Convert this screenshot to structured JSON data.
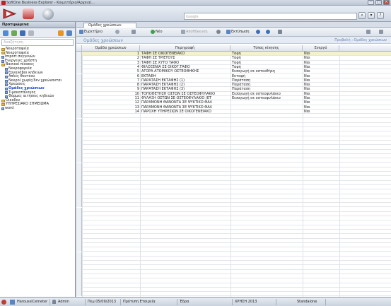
{
  "window": {
    "title": "SoftOne Business Explorer - Κοιμητήριο/Αρχεια/..."
  },
  "search": {
    "placeholder": "Google"
  },
  "sidebar": {
    "title": "Προτιμώμενα",
    "search_placeholder": "Αναζήτηση",
    "items": [
      {
        "label": "Νεκροταφεία",
        "indent": 0,
        "kind": "folder"
      },
      {
        "label": "Νεκροταφεία",
        "indent": 0,
        "kind": "folder"
      },
      {
        "label": "Import συγγενών",
        "indent": 0,
        "kind": "doc"
      },
      {
        "label": "Ενεργειες χρήστη",
        "indent": 0,
        "kind": "doc"
      },
      {
        "label": "Βασικοί πίνακες",
        "indent": 0,
        "kind": "folder"
      },
      {
        "label": "Νεκροφορεία",
        "indent": 1,
        "kind": "doc"
      },
      {
        "label": "Εργολάβοι κηδειών",
        "indent": 1,
        "kind": "doc"
      },
      {
        "label": "Απλές θουτέου",
        "indent": 1,
        "kind": "doc"
      },
      {
        "label": "Νεκροί χωρίς/δεν χρεώνονται",
        "indent": 1,
        "kind": "doc"
      },
      {
        "label": "Χρεώσεις",
        "indent": 1,
        "kind": "doc"
      },
      {
        "label": "Ομάδες χρεώσεων",
        "indent": 1,
        "kind": "doc",
        "selected": true
      },
      {
        "label": "Τιμοκατάλογος",
        "indent": 1,
        "kind": "doc"
      },
      {
        "label": "Φόρμες αιτήσεις κηδειών",
        "indent": 1,
        "kind": "doc"
      },
      {
        "label": "Οικοδεν",
        "indent": 0,
        "kind": "folder"
      },
      {
        "label": "ΥΠΗΡΕΣΙΑΚΟ ΣΗΜΕΙΩΜΑ",
        "indent": 0,
        "kind": "folder"
      },
      {
        "label": "word",
        "indent": 0,
        "kind": "doc"
      }
    ]
  },
  "tab": {
    "label": "Ομάδες χρεώσεων"
  },
  "toolbar": {
    "search_label": "Ευρετήριο",
    "new_label": "Νέο",
    "save_label": "Αποθήκευση",
    "print_label": "Εκτύπωση"
  },
  "subheader": {
    "left": "Ομάδες χρεώσεων",
    "right": "Προβολή : Ομάδες χρεώσεων"
  },
  "table": {
    "columns": [
      "Ομάδα χρεώσεων",
      "Περιγραφή",
      "Τύπος κίνησης",
      "Ενεργό"
    ],
    "rows": [
      {
        "num": "1",
        "desc": "ΤΑΦΗ ΣΕ ΟΙΚΟΓΕΝΕΙΑΚΟ",
        "type": "Ταφή",
        "active": "Ναι"
      },
      {
        "num": "2",
        "desc": "ΤΑΦΗ ΣΕ ΤΡΙΕΤΟΥΣ",
        "type": "Ταφή",
        "active": "Ναι"
      },
      {
        "num": "3",
        "desc": "ΤΑΦΗ ΣΕ ΧΥΤΟ ΤΑΦΟ",
        "type": "Ταφή",
        "active": "Ναι"
      },
      {
        "num": "4",
        "desc": "ΦΙΛΟΞΕΝΙΑ ΣΕ ΟΙΚΟΓ.ΤΑΦΟ",
        "type": "Ταφή",
        "active": "Ναι"
      },
      {
        "num": "5",
        "desc": "ΑΓΟΡΑ ΑΤΟΜΙΚΟΥ ΟΣΤΕΟΘΗΚΗΣ",
        "type": "Εισαγωγή σε οστεοθήκη",
        "active": "Ναι"
      },
      {
        "num": "6",
        "desc": "ΕΚΤΑΦΗ",
        "type": "Εκταφή",
        "active": "Ναι"
      },
      {
        "num": "7",
        "desc": "ΠΑΡΑΤΑΣΗ ΕΚΤΑΦΗΣ (1)",
        "type": "Παράταση",
        "active": "Ναι"
      },
      {
        "num": "8",
        "desc": "ΠΑΡΑΤΑΣΗ ΕΚΤΑΦΗΣ (2)",
        "type": "Παράταση",
        "active": "Ναι"
      },
      {
        "num": "9",
        "desc": "ΠΑΡΑΤΑΣΗ ΕΚΤΑΦΗΣ (3)",
        "type": "Παράταση",
        "active": "Ναι"
      },
      {
        "num": "10",
        "desc": "ΤΟΠΟΘΕΤΗΣΗ ΟΣΤΩΝ ΣΕ ΟΣΤΕΟΦΥΛΑΚΙΟ",
        "type": "Εισαγωγή σε οστεοφυλάκιο",
        "active": "Ναι"
      },
      {
        "num": "11",
        "desc": "ΦΥΛΑΞΗ ΟΣΤΩΝ ΣΕ ΟΣΤΕΟΦΥΛΑΚΙΟ (ΕΤ",
        "type": "Εισαγωγή σε οστεοφυλάκιο",
        "active": "Ναι"
      },
      {
        "num": "12",
        "desc": "ΠΑΡΑΜΟΝΗ ΘΑΝΟΝΤΑ ΣΕ ΨΥΚΤΙΚΟ ΘΑΛ",
        "type": "",
        "active": "Ναι"
      },
      {
        "num": "13",
        "desc": "ΠΑΡΑΜΟΝΗ ΘΑΝΟΝΤΑ ΣΕ ΨΥΚΤΙΚΟ ΘΑΛ",
        "type": "",
        "active": "Ναι"
      },
      {
        "num": "14",
        "desc": "ΠΑΡΟΧΗ ΥΠΗΡΕΣΙΩΝ ΣΕ ΟΙΚΟΓΕΝΕΙΑΚΟ",
        "type": "",
        "active": "Ναι"
      }
    ]
  },
  "status": {
    "user_db": "HaroussiCemeter",
    "user": "Admin",
    "date": "Πεμ 05/09/2013",
    "company": "Πρότυπη Εταιρεία",
    "branch": "Έδρα",
    "year": "ΧΡΗΣΗ 2013",
    "mode": "Standalone"
  },
  "colors": {
    "accent": "#c23b3b",
    "selected_row": "#f4f0d0",
    "link": "#1a3fbf"
  }
}
